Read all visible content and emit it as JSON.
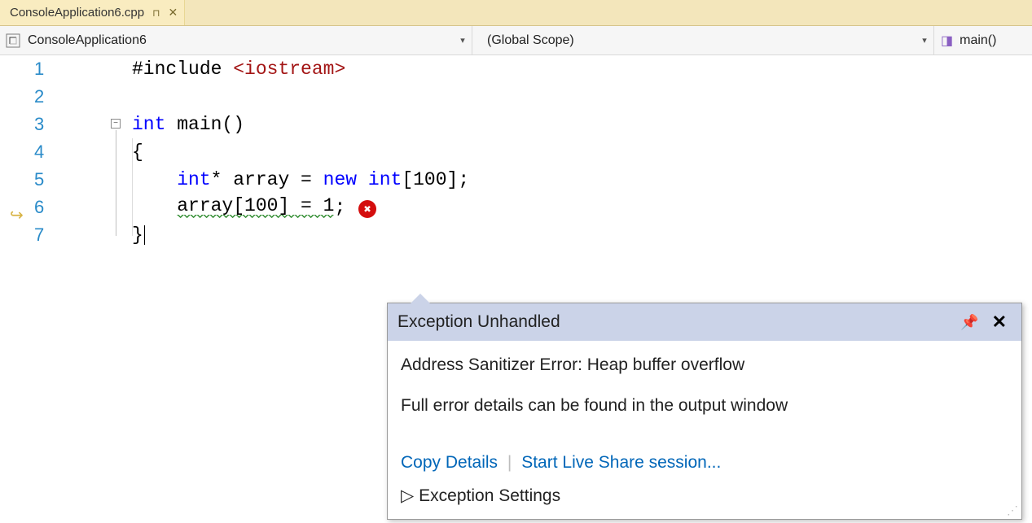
{
  "tab": {
    "filename": "ConsoleApplication6.cpp"
  },
  "nav": {
    "project": "ConsoleApplication6",
    "scope": "(Global Scope)",
    "function": "main()"
  },
  "code": {
    "lines": [
      "1",
      "2",
      "3",
      "4",
      "5",
      "6",
      "7"
    ],
    "l1_pre": "#include ",
    "l1_inc": "<iostream>",
    "l3_kw": "int",
    "l3_rest": " main()",
    "l4": "{",
    "l5_a": "    ",
    "l5_kw1": "int",
    "l5_b": "* array = ",
    "l5_kw2": "new",
    "l5_c": " ",
    "l5_kw3": "int",
    "l5_d": "[100];",
    "l6_a": "    ",
    "l6_sq": "array[100] = 1",
    "l6_b": ";",
    "l7": "}"
  },
  "popup": {
    "title": "Exception Unhandled",
    "error_line": "Address Sanitizer Error: Heap buffer overflow",
    "detail_line": "Full error details can be found in the output window",
    "copy_link": "Copy Details",
    "liveshare_link": "Start Live Share session...",
    "settings": "Exception Settings"
  }
}
